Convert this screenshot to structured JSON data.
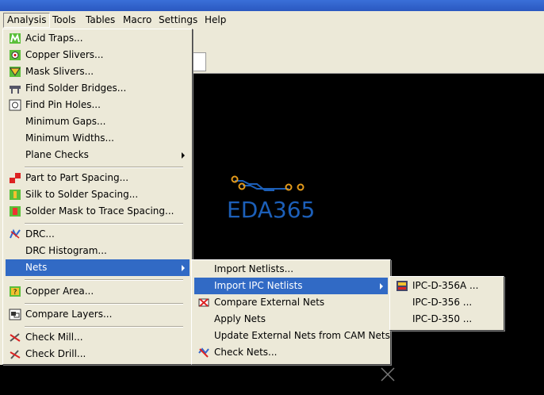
{
  "menubar": {
    "items": [
      {
        "label": "Analysis",
        "key": "analysis"
      },
      {
        "label": "Tools",
        "key": "tools"
      },
      {
        "label": "Tables",
        "key": "tables"
      },
      {
        "label": "Macro",
        "key": "macro"
      },
      {
        "label": "Settings",
        "key": "settings"
      },
      {
        "label": "Help",
        "key": "help"
      }
    ],
    "active": "Analysis"
  },
  "analysis_menu": {
    "items": [
      {
        "label": "Acid Traps...",
        "icon": "acid-traps-icon"
      },
      {
        "label": "Copper Slivers...",
        "icon": "copper-slivers-icon"
      },
      {
        "label": "Mask Slivers...",
        "icon": "mask-slivers-icon"
      },
      {
        "label": "Find Solder Bridges...",
        "icon": "solder-bridge-icon"
      },
      {
        "label": "Find Pin Holes...",
        "icon": "pin-holes-icon"
      },
      {
        "label": "Minimum Gaps...",
        "icon": ""
      },
      {
        "label": "Minimum Widths...",
        "icon": ""
      },
      {
        "label": "Plane Checks",
        "icon": "",
        "submenu": true
      },
      {
        "label": "Part to Part Spacing...",
        "icon": "part-spacing-icon"
      },
      {
        "label": "Silk to Solder Spacing...",
        "icon": "silk-spacing-icon"
      },
      {
        "label": "Solder Mask to Trace Spacing...",
        "icon": "mask-trace-icon"
      },
      {
        "label": "DRC...",
        "icon": "drc-icon"
      },
      {
        "label": "DRC Histogram...",
        "icon": ""
      },
      {
        "label": "Nets",
        "icon": "",
        "submenu": true,
        "highlighted": true
      },
      {
        "label": "Copper Area...",
        "icon": "copper-area-icon"
      },
      {
        "label": "Compare Layers...",
        "icon": "compare-layers-icon"
      },
      {
        "label": "Check Mill...",
        "icon": "check-mill-icon"
      },
      {
        "label": "Check Drill...",
        "icon": "check-drill-icon"
      }
    ]
  },
  "nets_menu": {
    "items": [
      {
        "label": "Import Netlists...",
        "icon": ""
      },
      {
        "label": "Import IPC Netlists",
        "icon": "",
        "submenu": true,
        "highlighted": true
      },
      {
        "label": "Compare External Nets",
        "icon": "compare-nets-icon"
      },
      {
        "label": "Apply Nets",
        "icon": ""
      },
      {
        "label": "Update External Nets from CAM Nets",
        "icon": ""
      },
      {
        "label": "Check Nets...",
        "icon": "check-nets-icon"
      }
    ]
  },
  "ipc_menu": {
    "items": [
      {
        "label": "IPC-D-356A ...",
        "icon": "ipc-356a-icon"
      },
      {
        "label": "IPC-D-356 ...",
        "icon": ""
      },
      {
        "label": "IPC-D-350 ...",
        "icon": ""
      }
    ]
  },
  "watermark": {
    "text": "EDA365"
  },
  "colors": {
    "menu_bg": "#ece9d8",
    "highlight": "#316ac5",
    "canvas": "#000000",
    "watermark": "#1c5fb8",
    "trace": "#e39a1b"
  }
}
